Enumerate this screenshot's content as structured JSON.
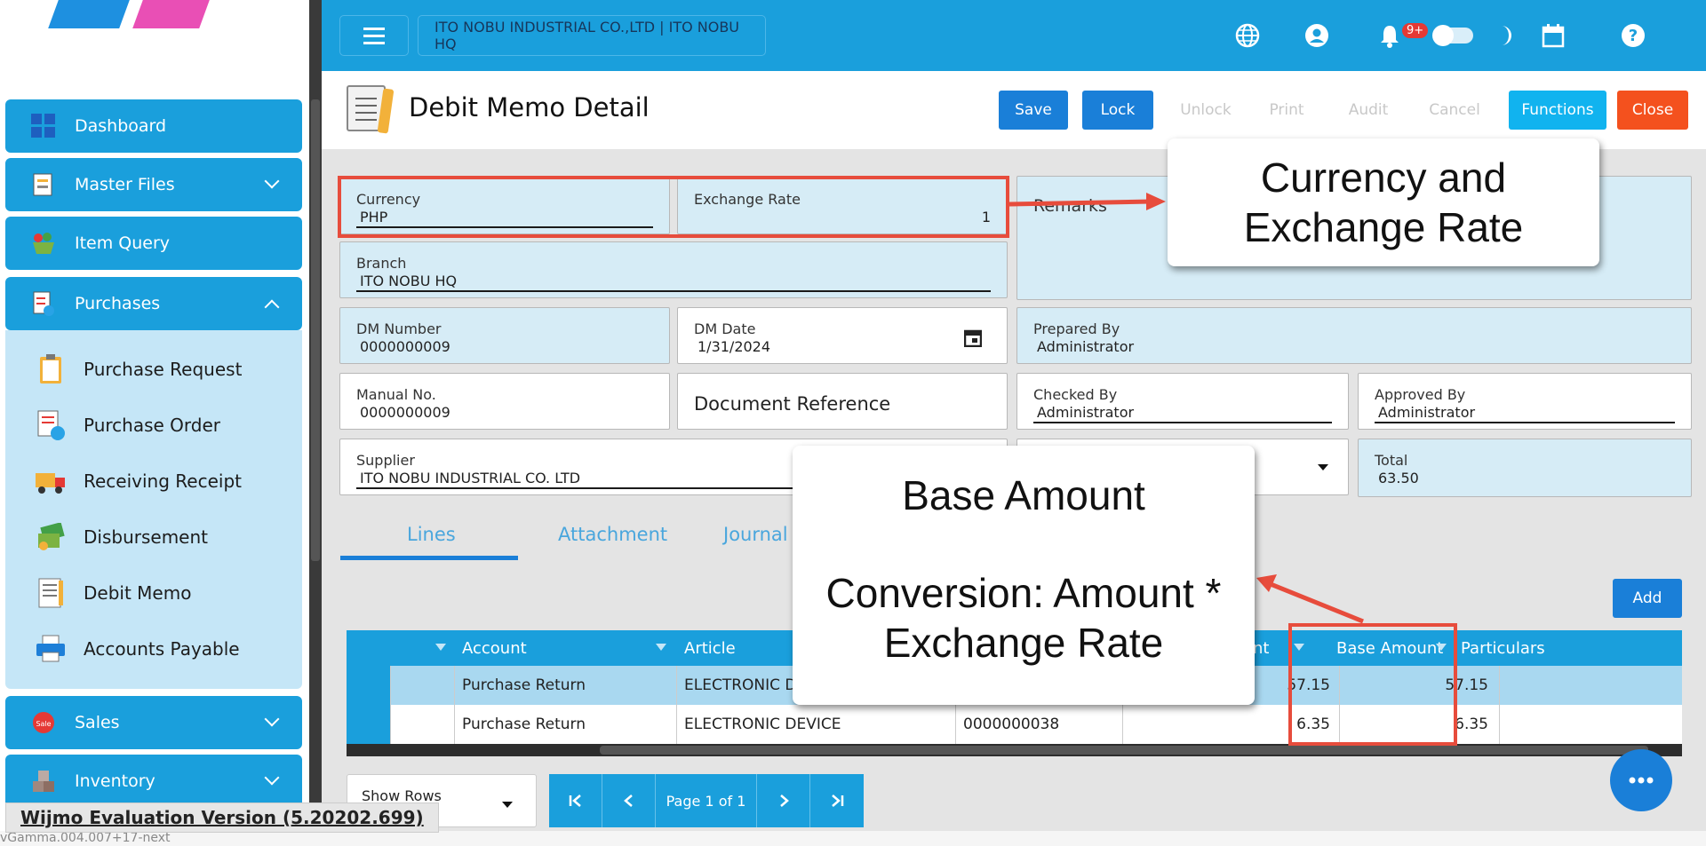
{
  "sidebar": {
    "items": [
      {
        "label": "Dashboard",
        "icon": "dashboard-icon"
      },
      {
        "label": "Master Files",
        "icon": "master-files-icon"
      },
      {
        "label": "Item Query",
        "icon": "basket-icon"
      },
      {
        "label": "Purchases",
        "icon": "purchases-icon"
      },
      {
        "label": "Sales",
        "icon": "sale-icon"
      },
      {
        "label": "Inventory",
        "icon": "boxes-icon"
      }
    ],
    "purchases_sub": [
      {
        "label": "Purchase Request",
        "icon": "clipboard-icon"
      },
      {
        "label": "Purchase Order",
        "icon": "order-icon"
      },
      {
        "label": "Receiving Receipt",
        "icon": "truck-icon"
      },
      {
        "label": "Disbursement",
        "icon": "money-icon"
      },
      {
        "label": "Debit Memo",
        "icon": "memo-icon"
      },
      {
        "label": "Accounts Payable",
        "icon": "printer-icon"
      }
    ]
  },
  "header": {
    "company": "ITO NOBU INDUSTRIAL CO.,LTD | ITO NOBU HQ",
    "notification_badge": "9+"
  },
  "page": {
    "title": "Debit Memo Detail",
    "actions": {
      "save": "Save",
      "lock": "Lock",
      "unlock": "Unlock",
      "print": "Print",
      "audit": "Audit",
      "cancel": "Cancel",
      "functions": "Functions",
      "close": "Close"
    }
  },
  "form": {
    "currency": {
      "label": "Currency",
      "value": "PHP"
    },
    "exchange_rate": {
      "label": "Exchange Rate",
      "value": "1"
    },
    "remarks": {
      "label": "Remarks"
    },
    "branch": {
      "label": "Branch",
      "value": "ITO NOBU HQ"
    },
    "dm_number": {
      "label": "DM Number",
      "value": "0000000009"
    },
    "dm_date": {
      "label": "DM Date",
      "value": "1/31/2024"
    },
    "prepared_by": {
      "label": "Prepared By",
      "value": "Administrator"
    },
    "manual_no": {
      "label": "Manual No.",
      "value": "0000000009"
    },
    "document_reference": {
      "placeholder": "Document Reference"
    },
    "checked_by": {
      "label": "Checked By",
      "value": "Administrator"
    },
    "approved_by": {
      "label": "Approved By",
      "value": "Administrator"
    },
    "supplier": {
      "label": "Supplier",
      "value": "ITO NOBU INDUSTRIAL CO. LTD"
    },
    "total": {
      "label": "Total",
      "value": "63.50"
    }
  },
  "tabs": [
    "Lines",
    "Attachment",
    "Journal E"
  ],
  "add_label": "Add",
  "grid": {
    "headers": {
      "account": "Account",
      "article": "Article",
      "amount_partial": "nt",
      "base_amount": "Base Amount",
      "particulars": "Particulars"
    },
    "rows": [
      {
        "account": "Purchase Return",
        "article": "ELECTRONIC D",
        "ref": "",
        "amount": "57.15",
        "base_amount": "57.15",
        "particulars": ""
      },
      {
        "account": "Purchase Return",
        "article": "ELECTRONIC DEVICE",
        "ref": "0000000038",
        "amount": "6.35",
        "base_amount": "6.35",
        "particulars": ""
      }
    ]
  },
  "pager": {
    "show_rows": "Show Rows",
    "page_info": "Page 1 of 1"
  },
  "annotations": {
    "currency_callout": "Currency and Exchange Rate",
    "base_title": "Base Amount",
    "base_body": "Conversion: Amount * Exchange Rate"
  },
  "footer": {
    "wijmo": "Wijmo Evaluation Version (5.20202.699)",
    "version": "vGamma.004.007+17-next"
  }
}
